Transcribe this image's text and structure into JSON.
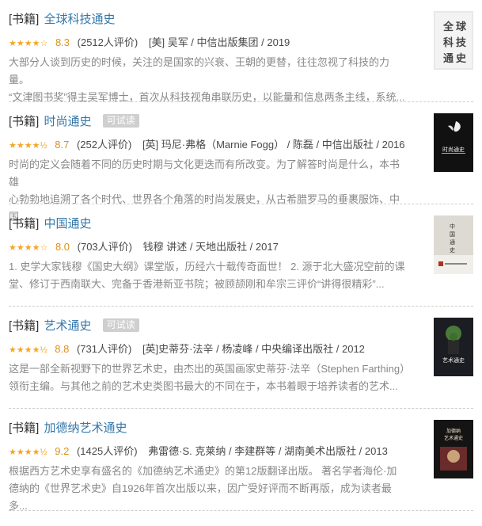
{
  "books": [
    {
      "category": "[书籍]",
      "title": "全球科技通史",
      "tag": "",
      "stars": "★★★★☆",
      "rating": "8.3",
      "count": "(2512人评价)",
      "publisher": "[美] 吴军 / 中信出版集团 / 2019",
      "desc": [
        "大部分人谈到历史的时候，关注的是国家的兴衰、王朝的更替，往往忽视了科技的力量。",
        "“文津图书奖”得主吴军博士，首次从科技视角串联历史，以能量和信息两条主线，系统..."
      ],
      "cover_text": "全球科技通史"
    },
    {
      "category": "[书籍]",
      "title": "时尚通史",
      "tag": "可试读",
      "stars": "★★★★½",
      "rating": "8.7",
      "count": "(252人评价)",
      "publisher": "[英] 玛尼·弗格（Marnie Fogg） / 陈磊 / 中信出版社 / 2016",
      "desc": [
        "时尚的定义会随着不同的历史时期与文化更迭而有所改变。为了解答时尚是什么，本书雄",
        "心勃勃地追溯了各个时代、世界各个角落的时尚发展史，从古希腊罗马的垂裹服饰、中",
        "国..."
      ],
      "cover_text": "时尚通史"
    },
    {
      "category": "[书籍]",
      "title": "中国通史",
      "tag": "",
      "stars": "★★★★☆",
      "rating": "8.0",
      "count": "(703人评价)",
      "publisher": "钱穆 讲述 / 天地出版社 / 2017",
      "desc": [
        "1. 史学大家钱穆《国史大纲》课堂版，历经六十载传奇面世！ 2. 源于北大盛况空前的课",
        "堂、修订于西南联大、完备于香港新亚书院；被顾颉刚和牟宗三评价“讲得很精彩”..."
      ],
      "cover_text": "中国通史"
    },
    {
      "category": "[书籍]",
      "title": "艺术通史",
      "tag": "可试读",
      "stars": "★★★★½",
      "rating": "8.8",
      "count": "(731人评价)",
      "publisher": "[英]史蒂芬·法辛 / 杨凌峰 / 中央编译出版社 / 2012",
      "desc": [
        "这是一部全新视野下的世界艺术史，由杰出的英国画家史蒂芬·法辛（Stephen Farthing）",
        "领衔主编。与其他之前的艺术史类图书最大的不同在于，本书着眼于培养读者的艺术..."
      ],
      "cover_text": "艺术通史"
    },
    {
      "category": "[书籍]",
      "title": "加德纳艺术通史",
      "tag": "",
      "stars": "★★★★½",
      "rating": "9.2",
      "count": "(1425人评价)",
      "publisher": "弗雷德·S. 克莱纳 / 李建群等 / 湖南美术出版社 / 2013",
      "desc": [
        "根据西方艺术史享有盛名的《加德纳艺术通史》的第12版翻译出版。 著名学者海伦·加",
        "德纳的《世界艺术史》自1926年首次出版以来，因广受好评而不断再版，成为读者最多..."
      ],
      "cover_text": "加德纳艺术通史"
    }
  ],
  "colors": {
    "link": "#3377aa",
    "star": "#f5a623",
    "tag_bg": "#cfcfcf"
  }
}
